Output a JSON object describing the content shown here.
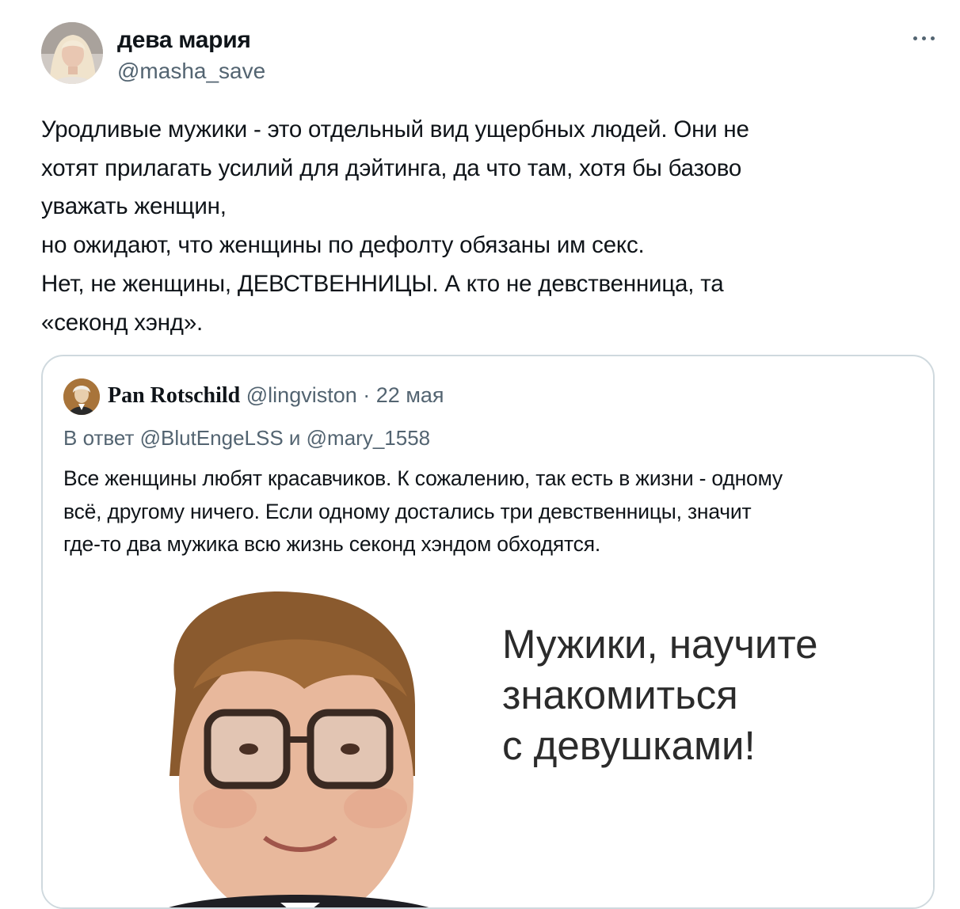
{
  "tweet": {
    "display_name": "дева мария",
    "handle": "@masha_save",
    "more_icon": "more-horizontal-icon",
    "text": "Уродливые мужики - это отдельный вид ущербных людей. Они не\nхотят прилагать усилий для дэйтинга, да что там, хотя бы базово\nуважать женщин,\nно ожидают, что женщины по дефолту обязаны им секс.\nНет, не женщины, ДЕВСТВЕННИЦЫ. А кто не девственница, та\n«секонд хэнд»."
  },
  "quoted_tweet": {
    "display_name": "Pan Rotschild",
    "handle": "@lingviston",
    "separator": "·",
    "date": "22 мая",
    "reply_to": "В ответ @BlutEngeLSS и @mary_1558",
    "text": "Все женщины любят красавчиков. К сожалению, так есть в жизни - одному\nвсё, другому ничего. Если одному достались три девственницы, значит\nгде-то два мужика всю жизнь секонд хэндом обходятся.",
    "image": {
      "caption": "Мужики, научите\nзнакомиться\nс девушками!"
    }
  },
  "colors": {
    "text": "#0f1419",
    "secondary": "#536471",
    "border": "#cfd9de"
  }
}
